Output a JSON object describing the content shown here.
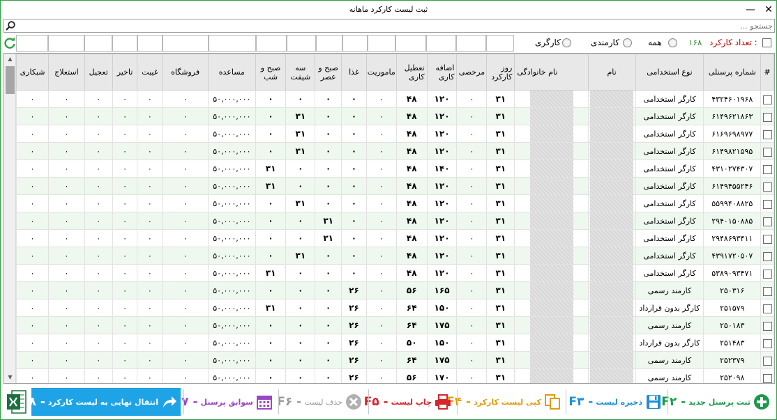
{
  "window": {
    "title": "ثبت لیست کارکرد ماهانه",
    "close_glyph": "✕",
    "minimize_glyph": "—"
  },
  "search": {
    "placeholder": "جستجو ..."
  },
  "filters": {
    "count_label": "تعداد کارکرد :",
    "count_value": "۱۶۸",
    "radio_all": "همه",
    "radio_employee": "کارمندی",
    "radio_worker": "کارگری"
  },
  "columns": [
    "#",
    "شماره پرسنلی",
    "نوع استخدامی",
    "نام",
    "نام خانوادگی",
    "روز کارکرد",
    "مرخصی",
    "اضافه کاری",
    "تعطیل کاری",
    "ماموریت",
    "غذا",
    "صبح و عصر",
    "سه شیفت",
    "صبح و شب",
    "مساعده",
    "فروشگاه",
    "غیبت",
    "تاخیر",
    "تعجیل",
    "استعلاج",
    "شبکاری"
  ],
  "rows": [
    {
      "id": "۴۳۲۴۶۰۱۹۶۸",
      "type": "کارگر استخدامی",
      "days": "۳۱",
      "leave": "۰",
      "overtime": "۱۲۰",
      "holiday": "۴۸",
      "mission": "۰",
      "food": "۰",
      "ma": "۰",
      "three": "۰",
      "mn": "۰",
      "advance": "۵۰,۰۰۰,۰۰۰",
      "store": "۰",
      "absence": "۰",
      "delay": "۰",
      "early": "۰",
      "sick": "۰",
      "night": "۰"
    },
    {
      "id": "۶۱۴۹۶۲۱۸۶۳",
      "type": "کارگر استخدامی",
      "days": "۳۱",
      "leave": "۰",
      "overtime": "۱۲۰",
      "holiday": "۴۸",
      "mission": "۰",
      "food": "۰",
      "ma": "۰",
      "three": "۳۱",
      "mn": "۰",
      "advance": "۵۰,۰۰۰,۰۰۰",
      "store": "۰",
      "absence": "۰",
      "delay": "۰",
      "early": "۰",
      "sick": "۰",
      "night": "۰"
    },
    {
      "id": "۶۱۶۹۶۹۸۹۷۷",
      "type": "کارگر استخدامی",
      "days": "۳۱",
      "leave": "۰",
      "overtime": "۱۲۰",
      "holiday": "۴۸",
      "mission": "۰",
      "food": "۰",
      "ma": "۰",
      "three": "۳۱",
      "mn": "۰",
      "advance": "۵۰,۰۰۰,۰۰۰",
      "store": "۰",
      "absence": "۰",
      "delay": "۰",
      "early": "۰",
      "sick": "۰",
      "night": "۰"
    },
    {
      "id": "۶۱۴۹۸۲۱۵۹۵",
      "type": "کارگر استخدامی",
      "days": "۳۱",
      "leave": "۰",
      "overtime": "۱۲۰",
      "holiday": "۴۸",
      "mission": "۰",
      "food": "۰",
      "ma": "۰",
      "three": "۳۱",
      "mn": "۰",
      "advance": "۵۰,۰۰۰,۰۰۰",
      "store": "۰",
      "absence": "۰",
      "delay": "۰",
      "early": "۰",
      "sick": "۰",
      "night": "۰"
    },
    {
      "id": "۴۳۱۰۲۷۴۳۰۷",
      "type": "کارگر استخدامی",
      "days": "۳۱",
      "leave": "۰",
      "overtime": "۱۴۰",
      "holiday": "۴۸",
      "mission": "۰",
      "food": "۰",
      "ma": "۰",
      "three": "۰",
      "mn": "۳۱",
      "advance": "۵۰,۰۰۰,۰۰۰",
      "store": "۰",
      "absence": "۰",
      "delay": "۰",
      "early": "۰",
      "sick": "۰",
      "night": "۰"
    },
    {
      "id": "۶۱۴۹۴۵۵۲۴۶",
      "type": "کارگر استخدامی",
      "days": "۳۱",
      "leave": "۰",
      "overtime": "۱۲۰",
      "holiday": "۴۸",
      "mission": "۰",
      "food": "۰",
      "ma": "۰",
      "three": "۰",
      "mn": "۳۱",
      "advance": "۵۰,۰۰۰,۰۰۰",
      "store": "۰",
      "absence": "۰",
      "delay": "۰",
      "early": "۰",
      "sick": "۰",
      "night": "۰"
    },
    {
      "id": "۵۵۹۹۴۰۸۸۲۵",
      "type": "کارگر استخدامی",
      "days": "۳۱",
      "leave": "۰",
      "overtime": "۱۲۰",
      "holiday": "۴۸",
      "mission": "۰",
      "food": "۰",
      "ma": "۰",
      "three": "۳۱",
      "mn": "۰",
      "advance": "۵۰,۰۰۰,۰۰۰",
      "store": "۰",
      "absence": "۰",
      "delay": "۰",
      "early": "۰",
      "sick": "۰",
      "night": "۰"
    },
    {
      "id": "۲۹۴۰۱۵۰۸۸۵",
      "type": "کارگر استخدامی",
      "days": "۳۱",
      "leave": "۰",
      "overtime": "۱۲۰",
      "holiday": "۴۸",
      "mission": "۰",
      "food": "۰",
      "ma": "۳۱",
      "three": "۰",
      "mn": "۰",
      "advance": "۵۰,۰۰۰,۰۰۰",
      "store": "۰",
      "absence": "۰",
      "delay": "۰",
      "early": "۰",
      "sick": "۰",
      "night": "۰"
    },
    {
      "id": "۲۹۴۸۶۹۳۴۱۱",
      "type": "کارگر استخدامی",
      "days": "۳۱",
      "leave": "۰",
      "overtime": "۱۲۰",
      "holiday": "۴۸",
      "mission": "۰",
      "food": "۰",
      "ma": "۳۱",
      "three": "۰",
      "mn": "۰",
      "advance": "۵۰,۰۰۰,۰۰۰",
      "store": "۰",
      "absence": "۰",
      "delay": "۰",
      "early": "۰",
      "sick": "۰",
      "night": "۰"
    },
    {
      "id": "۴۳۹۱۷۲۰۵۰۷",
      "type": "کارگر استخدامی",
      "days": "۳۱",
      "leave": "۰",
      "overtime": "۱۲۰",
      "holiday": "۴۸",
      "mission": "۰",
      "food": "۰",
      "ma": "۰",
      "three": "۳۱",
      "mn": "۰",
      "advance": "۵۰,۰۰۰,۰۰۰",
      "store": "۰",
      "absence": "۰",
      "delay": "۰",
      "early": "۰",
      "sick": "۰",
      "night": "۰"
    },
    {
      "id": "۵۳۸۹۰۹۳۴۷۱",
      "type": "کارگر استخدامی",
      "days": "۳۱",
      "leave": "۰",
      "overtime": "۱۲۰",
      "holiday": "۴۸",
      "mission": "۰",
      "food": "۰",
      "ma": "۰",
      "three": "۰",
      "mn": "۳۱",
      "advance": "۵۰,۰۰۰,۰۰۰",
      "store": "۰",
      "absence": "۰",
      "delay": "۰",
      "early": "۰",
      "sick": "۰",
      "night": "۰"
    },
    {
      "id": "۲۵۰۳۱۶",
      "type": "کارمند رسمی",
      "days": "۳۱",
      "leave": "۰",
      "overtime": "۱۶۵",
      "holiday": "۵۶",
      "mission": "۰",
      "food": "۲۶",
      "ma": "۰",
      "three": "۰",
      "mn": "۰",
      "advance": "۵۰,۰۰۰,۰۰۰",
      "store": "۰",
      "absence": "۰",
      "delay": "۰",
      "early": "۰",
      "sick": "۰",
      "night": "۰"
    },
    {
      "id": "۲۵۱۵۷۹",
      "type": "کارگر بدون قرارداد",
      "days": "۳۱",
      "leave": "۰",
      "overtime": "۱۵۰",
      "holiday": "۶۴",
      "mission": "۰",
      "food": "۲۶",
      "ma": "۰",
      "three": "۰",
      "mn": "۳۱",
      "advance": "۵۰,۰۰۰,۰۰۰",
      "store": "۰",
      "absence": "۰",
      "delay": "۰",
      "early": "۰",
      "sick": "۰",
      "night": "۰"
    },
    {
      "id": "۲۵۰۱۸۳",
      "type": "کارمند رسمی",
      "days": "۳۱",
      "leave": "۰",
      "overtime": "۱۷۵",
      "holiday": "۶۴",
      "mission": "۰",
      "food": "۲۶",
      "ma": "۰",
      "three": "۰",
      "mn": "۰",
      "advance": "۵۰,۰۰۰,۰۰۰",
      "store": "۰",
      "absence": "۰",
      "delay": "۰",
      "early": "۰",
      "sick": "۰",
      "night": "۰"
    },
    {
      "id": "۲۵۱۴۸۳",
      "type": "کارگر بدون قرارداد",
      "days": "۳۱",
      "leave": "۰",
      "overtime": "۱۵۰",
      "holiday": "۵۰",
      "mission": "۰",
      "food": "۲۶",
      "ma": "۰",
      "three": "۰",
      "mn": "۰",
      "advance": "۵۰,۰۰۰,۰۰۰",
      "store": "۰",
      "absence": "۰",
      "delay": "۰",
      "early": "۰",
      "sick": "۰",
      "night": "۰"
    },
    {
      "id": "۲۵۲۳۷۹",
      "type": "کارمند رسمی",
      "days": "۳۱",
      "leave": "۰",
      "overtime": "۱۷۵",
      "holiday": "۶۴",
      "mission": "۰",
      "food": "۲۶",
      "ma": "۰",
      "three": "۰",
      "mn": "۰",
      "advance": "۵۰,۰۰۰,۰۰۰",
      "store": "۰",
      "absence": "۰",
      "delay": "۰",
      "early": "۰",
      "sick": "۰",
      "night": "۰"
    },
    {
      "id": "۲۵۲۰۹۸",
      "type": "کارمند رسمی",
      "days": "۳۱",
      "leave": "۰",
      "overtime": "۱۷۰",
      "holiday": "۵۶",
      "mission": "۰",
      "food": "۲۶",
      "ma": "۰",
      "three": "۰",
      "mn": "۰",
      "advance": "۵۰,۰۰۰,۰۰۰",
      "store": "۰",
      "absence": "۰",
      "delay": "۰",
      "early": "۰",
      "sick": "۰",
      "night": "۰"
    }
  ],
  "toolbar": {
    "new_label": "ثبت پرسنل جدید",
    "new_key": "F۲ -",
    "save_label": "ذخیره لیست",
    "save_key": "F۳ -",
    "copy_label": "کپی لیست کارکرد",
    "copy_key": "F۴ -",
    "print_label": "چاپ لیست",
    "print_key": "F۵ -",
    "delete_label": "حذف لیست",
    "delete_key": "F۶ -",
    "history_label": "سوابق پرسنل",
    "history_key": "F۷ -",
    "transfer_label": "انتقال نهایی به لیست کارکرد",
    "transfer_key": "F۸ -"
  },
  "colors": {
    "accent_green": "#2ea043",
    "transfer_bg": "#1ea4e6",
    "new_color": "#1a9a4a",
    "save_color": "#1c8fd6",
    "copy_color": "#e39a0c",
    "print_color": "#d9242b",
    "delete_color": "#9a9a9a",
    "history_color": "#9b47c2"
  }
}
